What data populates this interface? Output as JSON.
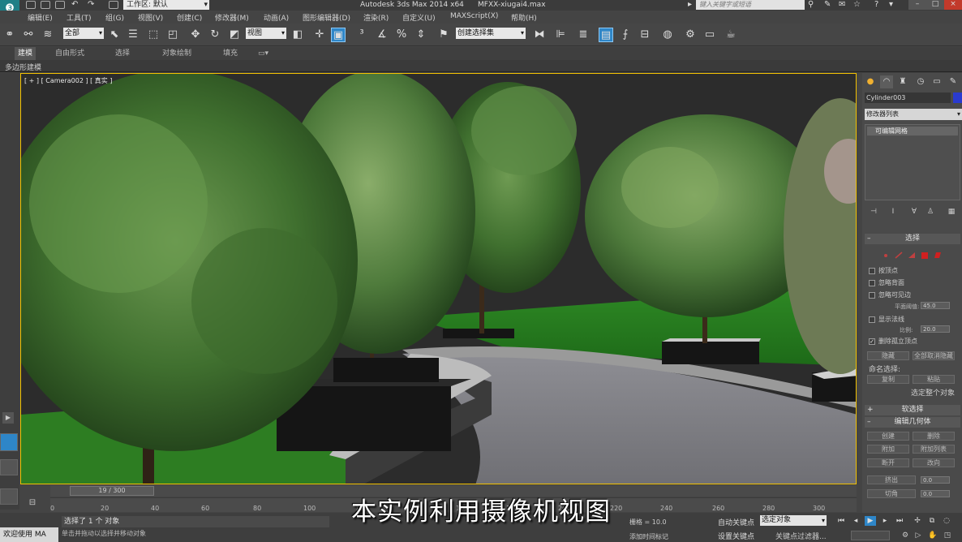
{
  "titlebar": {
    "workspace_label": "工作区: 默认",
    "app_title": "Autodesk 3ds Max  2014 x64",
    "document_name": "MFXX-xiugai4.max",
    "search_placeholder": "键入关键字或短语"
  },
  "menu": {
    "items": [
      "编辑(E)",
      "工具(T)",
      "组(G)",
      "视图(V)",
      "创建(C)",
      "修改器(M)",
      "动画(A)",
      "图形编辑器(D)",
      "渲染(R)",
      "自定义(U)",
      "MAXScript(X)",
      "帮助(H)"
    ]
  },
  "toolbar": {
    "selection_filter": "全部",
    "reference_coordinate": "视图",
    "named_selection_set": "创建选择集"
  },
  "ribbon": {
    "tabs": [
      "建模",
      "自由形式",
      "选择",
      "对象绘制",
      "填充"
    ],
    "active_tab": "建模",
    "sub_label": "多边形建模"
  },
  "viewport": {
    "label": "[ + ] [ Camera002 ] [ 真实 ]"
  },
  "timeline": {
    "slider_label": "19 / 300",
    "ticks": [
      "0",
      "20",
      "40",
      "60",
      "80",
      "100",
      "120",
      "140",
      "160",
      "180",
      "200",
      "220",
      "240",
      "260",
      "280",
      "300"
    ]
  },
  "command_panel": {
    "object_name": "Cylinder003",
    "object_color": "#2a3bd0",
    "modifier_list_label": "修改器列表",
    "stack_item": "可编辑网格",
    "selection_rollout": {
      "title": "选择",
      "by_vertex": "按顶点",
      "ignore_backfacing": "忽略背面",
      "ignore_visible_edges": "忽略可见边",
      "planar_threshold_label": "平面阈值:",
      "planar_threshold_value": "45.0",
      "show_normals": "显示法线",
      "scale_label": "比例:",
      "scale_value": "20.0",
      "delete_isolated": "删除孤立顶点",
      "hide_button": "隐藏",
      "unhide_all_button": "全部取消隐藏",
      "named_selections_label": "命名选择:",
      "copy_button": "复制",
      "paste_button": "粘贴",
      "selection_status": "选定整个对象"
    },
    "soft_selection_title": "软选择",
    "edit_geometry_title": "编辑几何体",
    "edit_geometry_buttons": [
      "创建",
      "删除",
      "附加",
      "附加列表",
      "断开",
      "改向"
    ],
    "extrude_label": "挤出",
    "extrude_value": "0.0",
    "chamfer_label": "切角",
    "chamfer_value": "0.0"
  },
  "status": {
    "maxscript_label": "欢迎使用 MA",
    "selection_text": "选择了 1 个 对象",
    "prompt_text": "单击并拖动以选择并移动对象",
    "grid_text": "栅格 = 10.0",
    "auto_key": "自动关键点",
    "set_key": "设置关键点",
    "selected_object": "选定对象",
    "key_filters": "关键点过滤器...",
    "add_time_tag": "添加时间标记"
  },
  "subtitle": "本实例利用摄像机视图"
}
